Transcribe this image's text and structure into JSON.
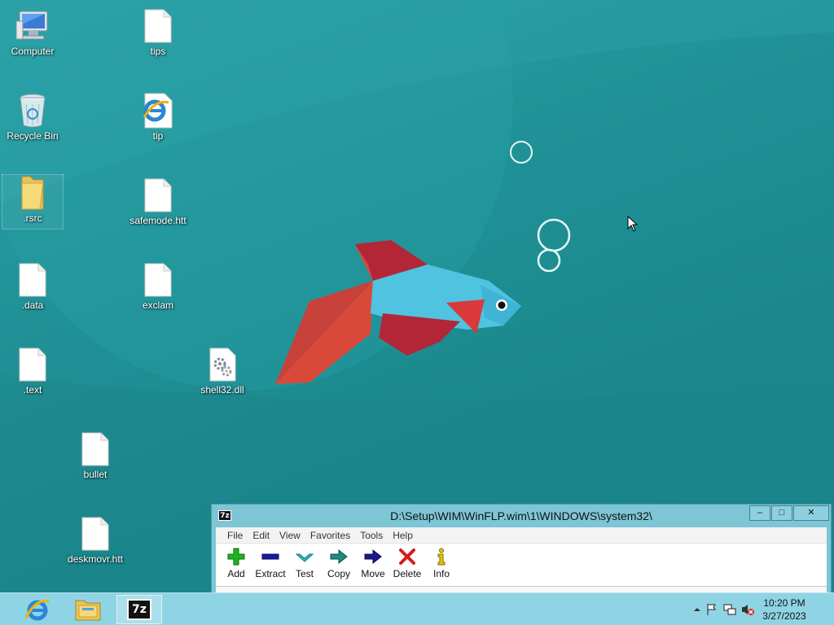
{
  "desktop": {
    "icons": [
      {
        "label": "Computer",
        "icon": "computer-icon"
      },
      {
        "label": "tips",
        "icon": "document-icon"
      },
      {
        "label": "Recycle Bin",
        "icon": "recycle-bin-icon"
      },
      {
        "label": "tip",
        "icon": "internet-explorer-document-icon"
      },
      {
        "label": ".rsrc",
        "icon": "folder-icon"
      },
      {
        "label": "safemode.htt",
        "icon": "document-icon"
      },
      {
        "label": ".data",
        "icon": "document-icon"
      },
      {
        "label": "exclam",
        "icon": "document-icon"
      },
      {
        "label": ".text",
        "icon": "document-icon"
      },
      {
        "label": "shell32.dll",
        "icon": "dll-settings-icon"
      },
      {
        "label": "bullet",
        "icon": "document-icon"
      },
      {
        "label": "deskmovr.htt",
        "icon": "document-icon"
      }
    ]
  },
  "zip_window": {
    "title": "D:\\Setup\\WIM\\WinFLP.wim\\1\\WINDOWS\\system32\\",
    "controls": {
      "minimize": "–",
      "maximize": "□",
      "close": "✕"
    },
    "menu": [
      "File",
      "Edit",
      "View",
      "Favorites",
      "Tools",
      "Help"
    ],
    "toolbar": [
      {
        "label": "Add",
        "icon": "add-plus-icon",
        "color": "#1db31d"
      },
      {
        "label": "Extract",
        "icon": "extract-minus-icon",
        "color": "#1a1aa0"
      },
      {
        "label": "Test",
        "icon": "test-check-icon",
        "color": "#2ab7c9"
      },
      {
        "label": "Copy",
        "icon": "copy-arrow-icon",
        "color": "#1f8a7d"
      },
      {
        "label": "Move",
        "icon": "move-arrow-icon",
        "color": "#1a1a8c"
      },
      {
        "label": "Delete",
        "icon": "delete-x-icon",
        "color": "#d81a1a"
      },
      {
        "label": "Info",
        "icon": "info-icon",
        "color": "#e8c800"
      }
    ]
  },
  "taskbar": {
    "pinned": [
      {
        "name": "internet-explorer",
        "icon": "internet-explorer-icon"
      },
      {
        "name": "file-explorer",
        "icon": "file-explorer-icon"
      },
      {
        "name": "7zip",
        "icon": "7zip-icon",
        "label": "7z"
      }
    ],
    "tray": {
      "time": "10:20 PM",
      "date": "3/27/2023"
    }
  },
  "colors": {
    "desktop_bg": "#1f8e93",
    "taskbar_bg": "#8fd4e4",
    "window_frame": "#7dc6d6"
  }
}
